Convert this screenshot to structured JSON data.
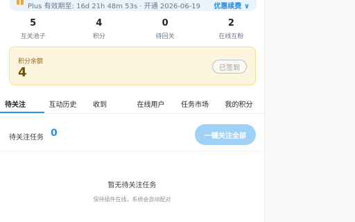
{
  "plus_bar": {
    "text": "Plus 有效期至: 16d 21h 48m 53s · 开通 2026-06-19",
    "renew_label": "优惠续费 ∨"
  },
  "stats": [
    {
      "value": "5",
      "label": "互关池子"
    },
    {
      "value": "4",
      "label": "积分"
    },
    {
      "value": "0",
      "label": "待回关"
    },
    {
      "value": "2",
      "label": "在线互粉"
    }
  ],
  "balance": {
    "label": "积分余额",
    "value": "4",
    "checked_in_label": "已签到"
  },
  "tabs": [
    {
      "label": "待关注",
      "active": true
    },
    {
      "label": "互动历史",
      "active": false
    },
    {
      "label": "收到",
      "active": false
    },
    {
      "label": "在线用户",
      "active": false
    },
    {
      "label": "任务市场",
      "active": false
    },
    {
      "label": "我的积分",
      "active": false
    }
  ],
  "pending": {
    "label": "待关注任务",
    "count": "0",
    "follow_all_label": "一键关注全部"
  },
  "empty_state": {
    "title": "暂无待关注任务",
    "subtitle": "保持插件在线，系统会自动配对"
  },
  "colors": {
    "accent": "#2d8ee0",
    "card_bg": "#fdf5dd",
    "button_disabled": "#9fd0f5"
  }
}
